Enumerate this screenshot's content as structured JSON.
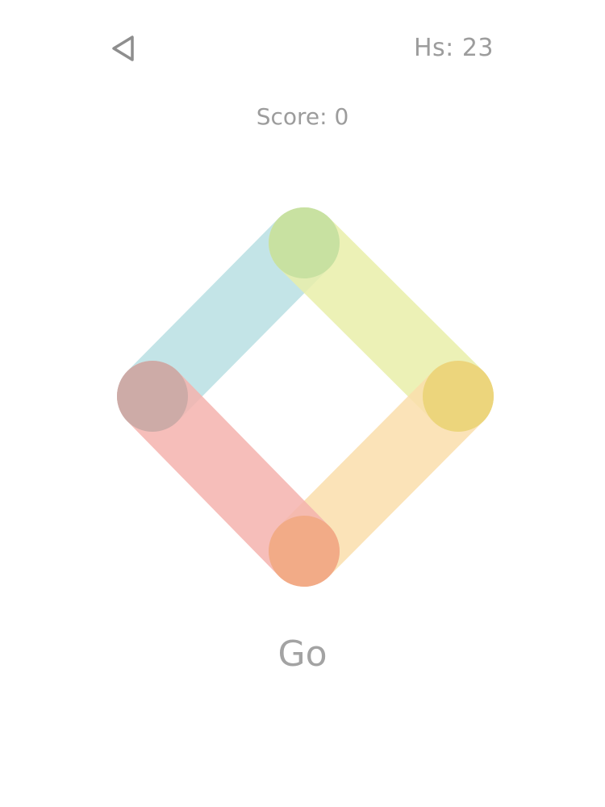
{
  "header": {
    "back_icon": "back-triangle-icon",
    "highscore_text": "Hs: 23"
  },
  "score": {
    "text": "Score: 0"
  },
  "board": {
    "arms": [
      {
        "name": "top-left-arm",
        "color": "#b9e0e3"
      },
      {
        "name": "top-right-arm",
        "color": "#e9efaa"
      },
      {
        "name": "bottom-right-arm",
        "color": "#fbdfac"
      },
      {
        "name": "bottom-left-arm",
        "color": "#f5b3ae"
      }
    ],
    "nodes": [
      {
        "name": "top-node",
        "color": "#c5df9f"
      },
      {
        "name": "right-node",
        "color": "#ead477"
      },
      {
        "name": "bottom-node",
        "color": "#f1a983"
      },
      {
        "name": "left-node",
        "color": "#caa9a6"
      }
    ]
  },
  "actions": {
    "go_label": "Go"
  }
}
